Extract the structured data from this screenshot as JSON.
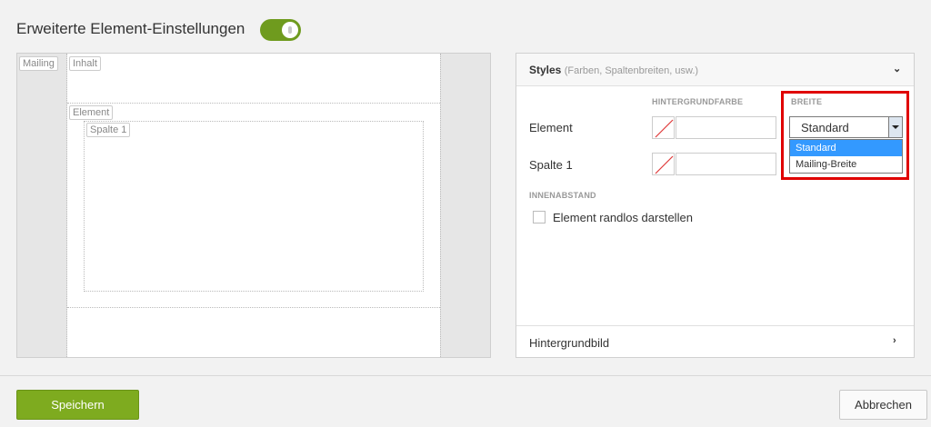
{
  "header": {
    "title": "Erweiterte Element-Einstellungen",
    "toggle_on": true
  },
  "preview": {
    "tags": {
      "mailing": "Mailing",
      "inhalt": "Inhalt",
      "element": "Element",
      "spalte": "Spalte 1"
    }
  },
  "styles_panel": {
    "title": "Styles",
    "subtitle": "(Farben, Spaltenbreiten, usw.)",
    "col_background": "HINTERGRUNDFARBE",
    "col_width": "BREITE",
    "rows": [
      {
        "label": "Element"
      },
      {
        "label": "Spalte 1"
      }
    ],
    "width_select": {
      "value": "Standard",
      "options": [
        "Standard",
        "Mailing-Breite"
      ],
      "selected_index": 0
    },
    "section_padding": "INNENABSTAND",
    "checkbox_label": "Element randlos darstellen",
    "checkbox_checked": false,
    "background_image_label": "Hintergrundbild"
  },
  "footer": {
    "save_label": "Speichern",
    "cancel_label": "Abbrechen"
  },
  "colors": {
    "accent": "#7eab1f",
    "highlight": "#e00000",
    "selected_option": "#3399ff"
  }
}
